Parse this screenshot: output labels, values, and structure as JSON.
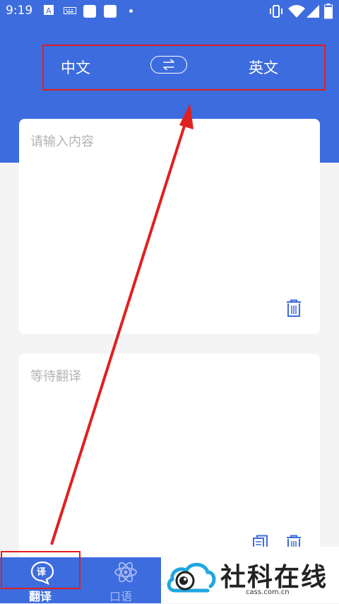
{
  "status_bar": {
    "time": "9:19",
    "left_icons": [
      "translate-app-icon",
      "keyboard-icon",
      "app-icon",
      "app-icon",
      "dot-icon"
    ],
    "right_icons": [
      "vibrate-icon",
      "wifi-icon",
      "signal-icon",
      "battery-icon"
    ]
  },
  "language_bar": {
    "source": "中文",
    "target": "英文",
    "swap_icon": "swap-arrows-icon"
  },
  "input_card": {
    "placeholder": "请输入内容",
    "delete_icon": "trash-icon"
  },
  "output_card": {
    "placeholder": "等待翻译",
    "copy_icon": "copy-icon",
    "delete_icon": "trash-icon"
  },
  "bottom_nav": {
    "items": [
      {
        "label": "翻译",
        "icon": "translate-bubble-icon",
        "active": true
      },
      {
        "label": "口语",
        "icon": "atom-icon",
        "active": false
      }
    ]
  },
  "watermark": {
    "title": "社科在线",
    "url": "cass.com.cn"
  },
  "colors": {
    "primary": "#3d6cde",
    "background": "#f4f4f4",
    "annotation_red": "#e02020"
  }
}
